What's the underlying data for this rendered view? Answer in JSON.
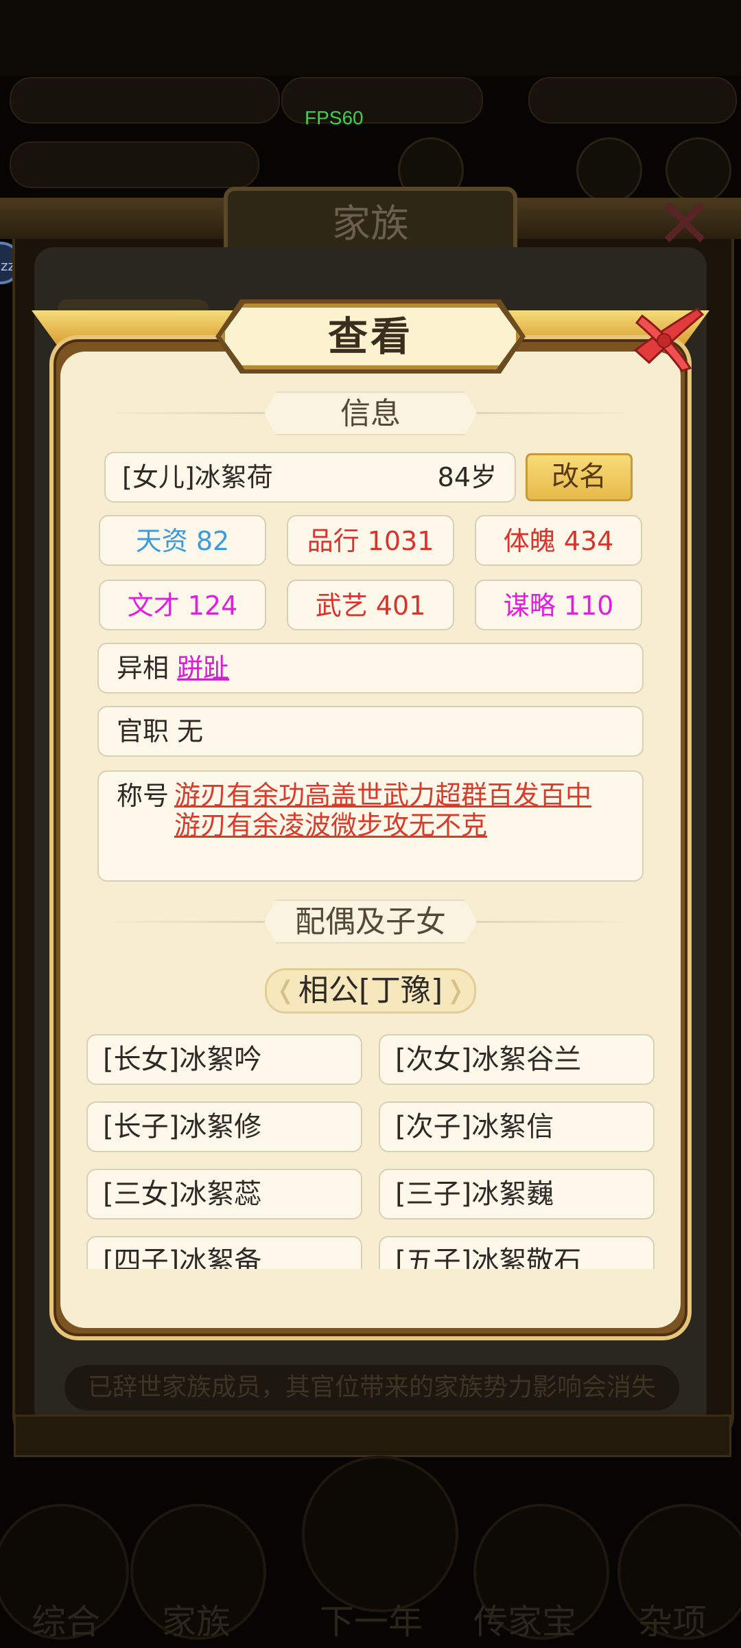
{
  "overlay": {
    "fps": "FPS60",
    "side_bubble": "zz"
  },
  "background": {
    "window_title": "家族",
    "bottom_note": "已辞世家族成员，其官位带来的家族势力影响会消失",
    "nav": [
      "综合",
      "家族",
      "下一年",
      "传家宝",
      "杂项"
    ]
  },
  "dialog": {
    "title": "查看",
    "info_header": "信息",
    "member": {
      "name": "[女儿]冰絮荷",
      "age": "84岁"
    },
    "rename_label": "改名",
    "stats": [
      {
        "label": "天资 82",
        "color": "#3a9be0"
      },
      {
        "label": "品行 1031",
        "color": "#d9332b"
      },
      {
        "label": "体魄 434",
        "color": "#d9332b"
      },
      {
        "label": "文才 124",
        "color": "#e01de0"
      },
      {
        "label": "武艺 401",
        "color": "#d9332b"
      },
      {
        "label": "谋略 110",
        "color": "#e01de0"
      }
    ],
    "trait": {
      "label": "异相",
      "value": "跰趾"
    },
    "office": {
      "label": "官职",
      "value": "无"
    },
    "titles": {
      "label": "称号",
      "line1": "游刃有余功高盖世武力超群百发百中",
      "line2": "游刃有余凌波微步攻无不克"
    },
    "family_header": "配偶及子女",
    "spouse": "相公[丁豫]",
    "children": [
      "[长女]冰絮吟",
      "[次女]冰絮谷兰",
      "[长子]冰絮修",
      "[次子]冰絮信",
      "[三女]冰絮蕊",
      "[三子]冰絮巍",
      "[四子]冰絮备",
      "[五子]冰絮敬石"
    ]
  }
}
